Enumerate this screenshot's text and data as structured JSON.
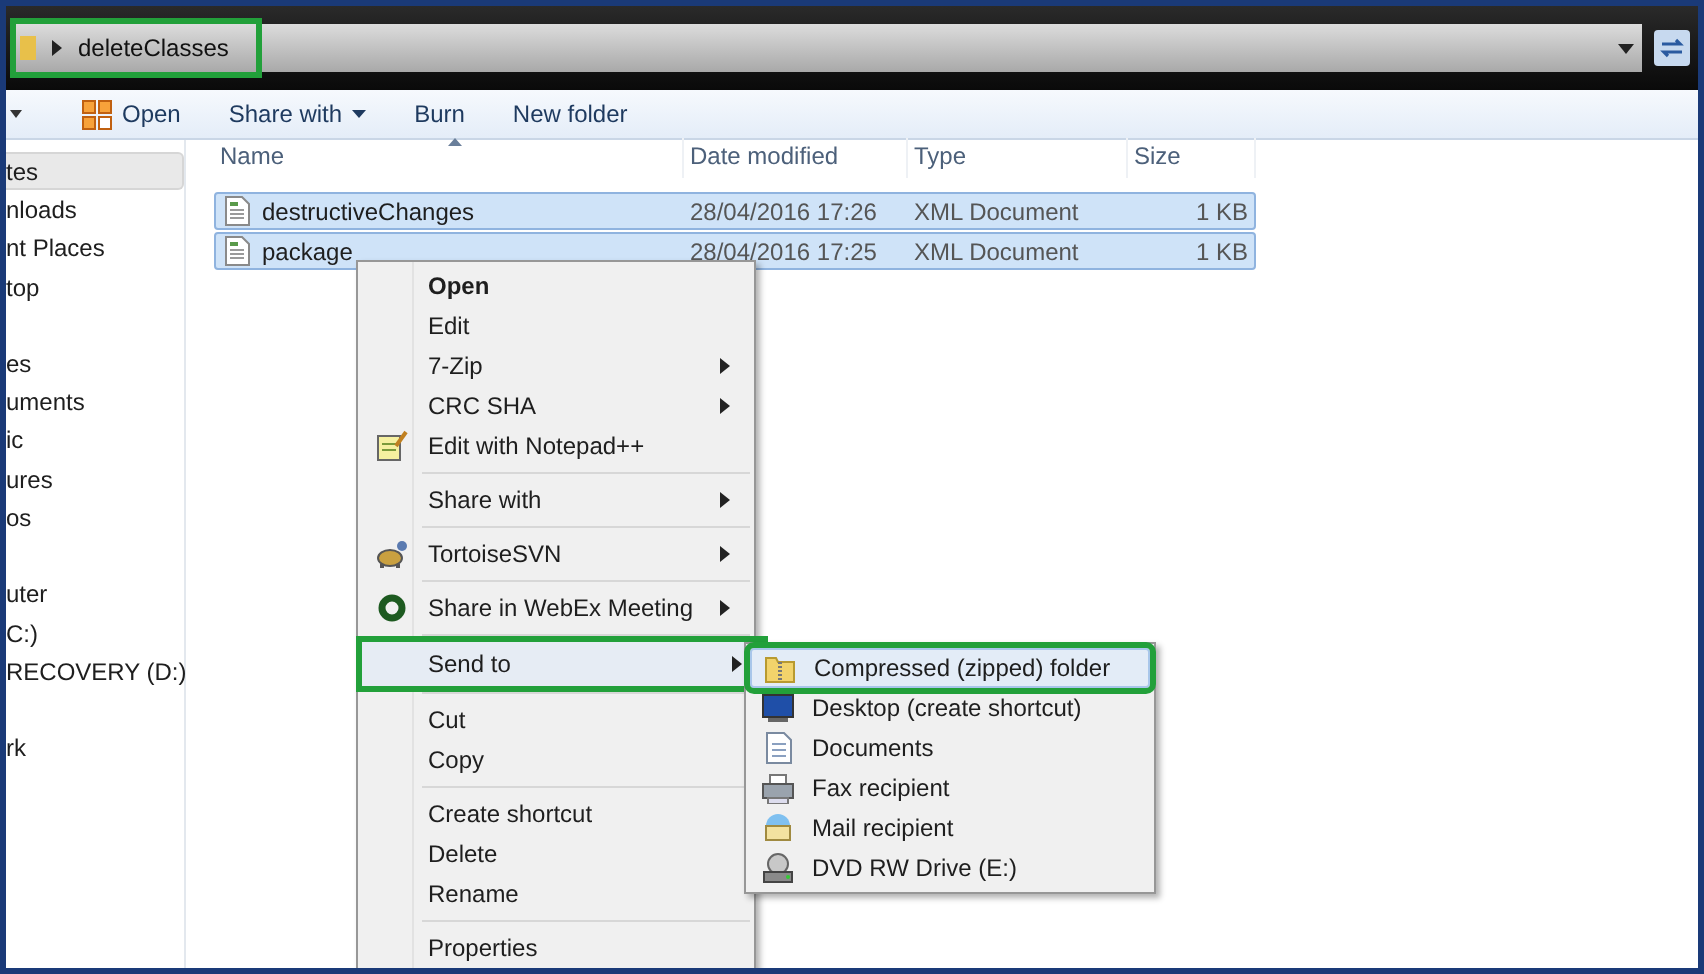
{
  "address_bar": {
    "path": "deleteClasses",
    "outlined": true
  },
  "toolbar": [
    {
      "label": "Open",
      "kind": "with_icon"
    },
    {
      "label": "Share with",
      "kind": "dropdown"
    },
    {
      "label": "Burn",
      "kind": "plain"
    },
    {
      "label": "New folder",
      "kind": "plain"
    }
  ],
  "sidebar": {
    "groups": [
      [
        {
          "label": "tes",
          "selected": true
        },
        {
          "label": "nloads",
          "selected": false
        },
        {
          "label": "nt Places",
          "selected": false
        },
        {
          "label": "top",
          "selected": false
        }
      ],
      [
        {
          "label": "es",
          "selected": false
        },
        {
          "label": "uments",
          "selected": false
        },
        {
          "label": "ic",
          "selected": false
        },
        {
          "label": "ures",
          "selected": false
        },
        {
          "label": "os",
          "selected": false
        }
      ],
      [
        {
          "label": "uter",
          "selected": false
        },
        {
          "label": "C:)",
          "selected": false
        },
        {
          "label": "RECOVERY (D:)",
          "selected": false
        }
      ],
      [
        {
          "label": "rk",
          "selected": false
        }
      ]
    ]
  },
  "table": {
    "columns": [
      {
        "label": "Name",
        "sorted": true
      },
      {
        "label": "Date modified",
        "sorted": false
      },
      {
        "label": "Type",
        "sorted": false
      },
      {
        "label": "Size",
        "sorted": false
      }
    ],
    "rows": [
      {
        "name": "destructiveChanges",
        "date": "28/04/2016 17:26",
        "type": "XML Document",
        "size": "1 KB",
        "selected": true
      },
      {
        "name": "package",
        "date": "28/04/2016 17:25",
        "type": "XML Document",
        "size": "1 KB",
        "selected": true
      }
    ]
  },
  "context_menu": {
    "groups": [
      [
        {
          "label": "Open",
          "bold": true,
          "submenu": false,
          "selected": false,
          "outlined": false
        },
        {
          "label": "Edit",
          "bold": false,
          "submenu": false,
          "selected": false,
          "outlined": false
        },
        {
          "label": "7-Zip",
          "bold": false,
          "submenu": true,
          "selected": false,
          "outlined": false
        },
        {
          "label": "CRC SHA",
          "bold": false,
          "submenu": true,
          "selected": false,
          "outlined": false
        },
        {
          "label": "Edit with Notepad++",
          "bold": false,
          "submenu": false,
          "selected": false,
          "outlined": false
        }
      ],
      [
        {
          "label": "Share with",
          "bold": false,
          "submenu": true,
          "selected": false,
          "outlined": false
        }
      ],
      [
        {
          "label": "TortoiseSVN",
          "bold": false,
          "submenu": true,
          "selected": false,
          "outlined": false
        }
      ],
      [
        {
          "label": "Share in WebEx Meeting",
          "bold": false,
          "submenu": true,
          "selected": false,
          "outlined": false
        }
      ],
      [
        {
          "label": "Send to",
          "bold": false,
          "submenu": true,
          "selected": true,
          "outlined": true
        }
      ],
      [
        {
          "label": "Cut",
          "bold": false,
          "submenu": false,
          "selected": false,
          "outlined": false
        },
        {
          "label": "Copy",
          "bold": false,
          "submenu": false,
          "selected": false,
          "outlined": false
        }
      ],
      [
        {
          "label": "Create shortcut",
          "bold": false,
          "submenu": false,
          "selected": false,
          "outlined": false
        },
        {
          "label": "Delete",
          "bold": false,
          "submenu": false,
          "selected": false,
          "outlined": false
        },
        {
          "label": "Rename",
          "bold": false,
          "submenu": false,
          "selected": false,
          "outlined": false
        }
      ],
      [
        {
          "label": "Properties",
          "bold": false,
          "submenu": false,
          "selected": false,
          "outlined": false
        }
      ]
    ]
  },
  "send_to_menu": {
    "items": [
      {
        "label": "Compressed (zipped) folder",
        "selected": true,
        "outlined": true
      },
      {
        "label": "Desktop (create shortcut)",
        "selected": false,
        "outlined": false
      },
      {
        "label": "Documents",
        "selected": false,
        "outlined": false
      },
      {
        "label": "Fax recipient",
        "selected": false,
        "outlined": false
      },
      {
        "label": "Mail recipient",
        "selected": false,
        "outlined": false
      },
      {
        "label": "DVD RW Drive (E:)",
        "selected": false,
        "outlined": false
      }
    ]
  }
}
